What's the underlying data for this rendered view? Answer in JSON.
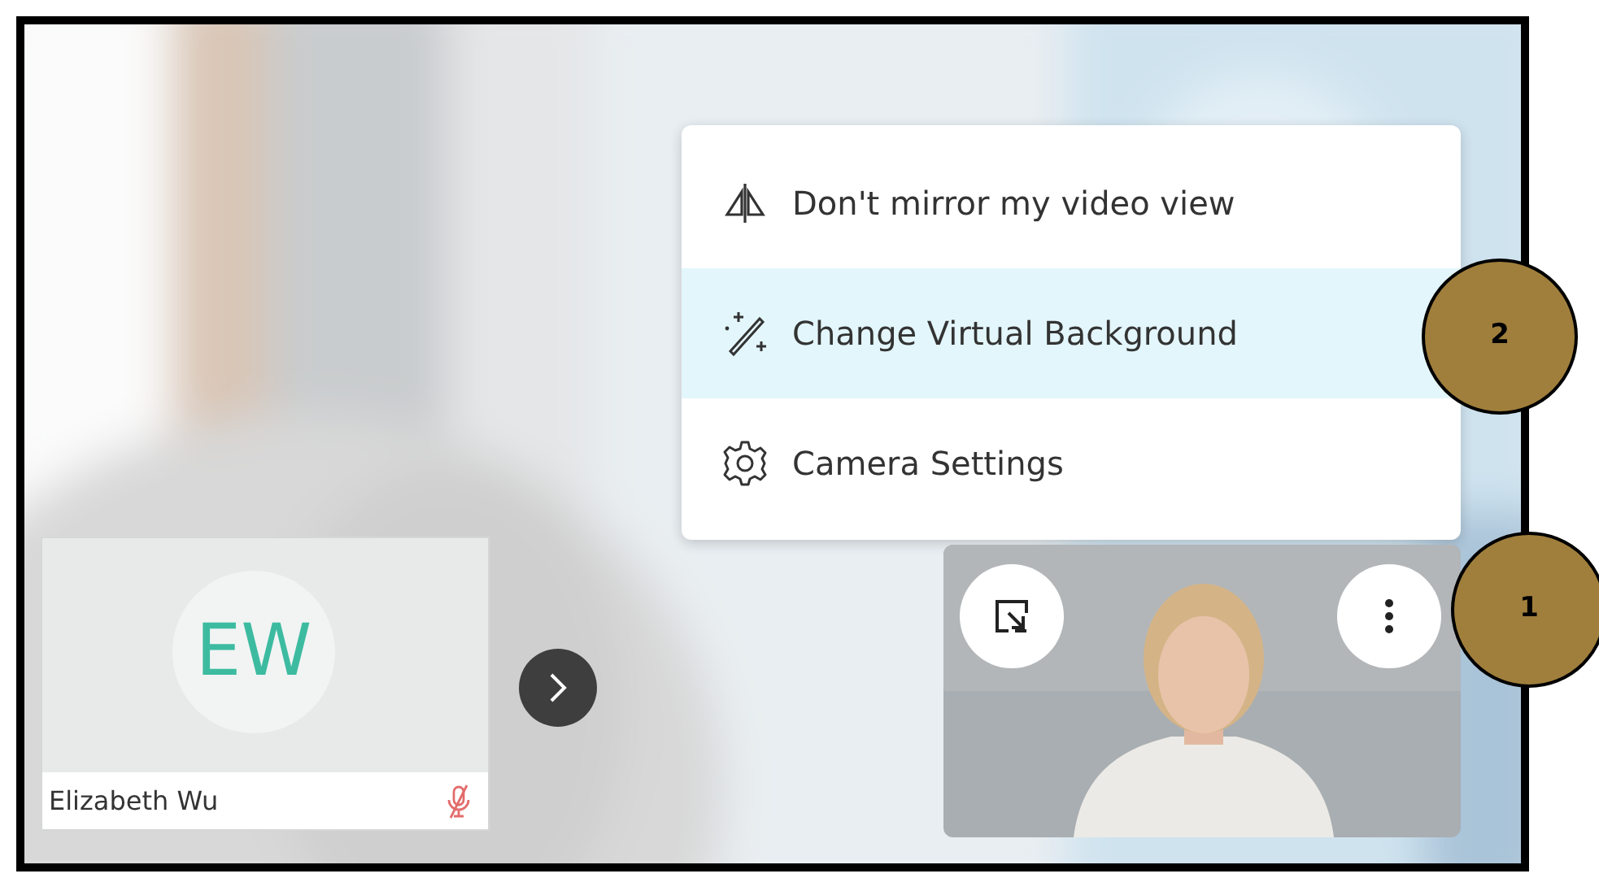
{
  "menu": {
    "items": [
      {
        "label": "Don't mirror my video view",
        "kind": "mirror",
        "selected": false
      },
      {
        "label": "Change Virtual Background",
        "kind": "background",
        "selected": true
      },
      {
        "label": "Camera Settings",
        "kind": "settings",
        "selected": false
      }
    ]
  },
  "participant": {
    "initials": "EW",
    "name": "Elizabeth Wu",
    "muted": true
  },
  "callouts": [
    {
      "label": "2"
    },
    {
      "label": "1"
    }
  ]
}
